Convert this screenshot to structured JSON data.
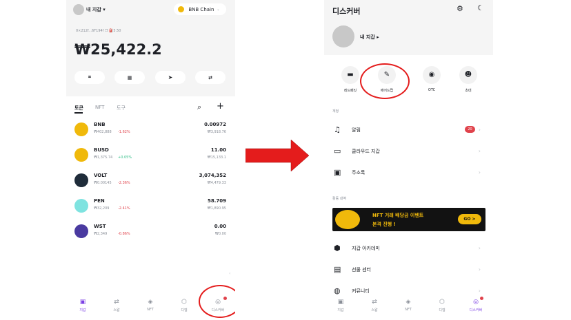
{
  "left": {
    "wallet_label": "내 지갑",
    "chain_label": "BNB Chain",
    "address": "0×212f...6F194f",
    "gas": "5.50",
    "balance": "₩25,422.2",
    "tabs": [
      "토큰",
      "NFT",
      "도구"
    ],
    "tokens": [
      {
        "symbol": "BNB",
        "price": "₩402,888",
        "change": "-1.62%",
        "dir": "neg",
        "amount": "0.00972",
        "value": "₩3,918.76",
        "color": "#f0b90b"
      },
      {
        "symbol": "BUSD",
        "price": "₩1,375.74",
        "change": "+0.05%",
        "dir": "pos",
        "amount": "11.00",
        "value": "₩15,133.1",
        "color": "#f0b90b"
      },
      {
        "symbol": "VOLT",
        "price": "₩0.00145",
        "change": "-2.36%",
        "dir": "neg",
        "amount": "3,074,352",
        "value": "₩4,479.33",
        "color": "#1f2c3a"
      },
      {
        "symbol": "PEN",
        "price": "₩32,209",
        "change": "-2.41%",
        "dir": "neg",
        "amount": "58.709",
        "value": "₩1,890.95",
        "color": "#7fe3e0"
      },
      {
        "symbol": "WST",
        "price": "₩2,349",
        "change": "-0.86%",
        "dir": "neg",
        "amount": "0.00",
        "value": "₩0.00",
        "color": "#4a3aa0"
      }
    ],
    "nav": [
      "지갑",
      "스왑",
      "NFT",
      "디엡",
      "디스커버"
    ]
  },
  "right": {
    "title": "디스커버",
    "wallet_label": "내 지갑",
    "quick": [
      "레드패킷",
      "에어드랍",
      "OTC",
      "초대"
    ],
    "section_account": "계정",
    "account_rows": [
      {
        "label": "알림",
        "badge": "20"
      },
      {
        "label": "클라우드 지갑",
        "badge": ""
      },
      {
        "label": "주소록",
        "badge": ""
      }
    ],
    "section_activity": "활동 내역",
    "banner_line1": "NFT 거래 배당금 이벤트",
    "banner_line2": "본격 진행 !",
    "banner_button": "GO >",
    "more_rows": [
      "지갑 아카데미",
      "선물 센터",
      "커뮤니티"
    ],
    "nav": [
      "지갑",
      "스왑",
      "NFT",
      "디엡",
      "디스커버"
    ]
  },
  "colors": {
    "accent": "#7b3fe4",
    "negative": "#e0424b",
    "positive": "#2ebd85",
    "arrow": "#e41c1c",
    "bnb": "#f0b90b"
  }
}
